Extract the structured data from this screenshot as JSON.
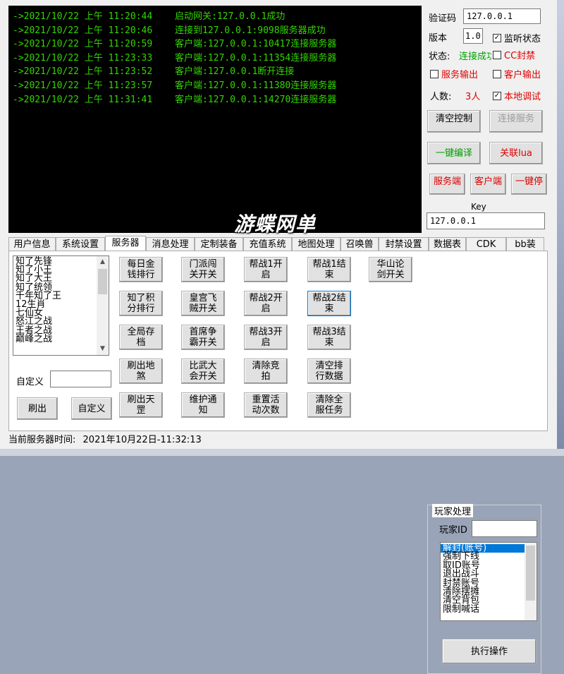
{
  "console": {
    "lines": [
      {
        "time": "->2021/10/22 上午 11:20:44",
        "msg": "启动网关:127.0.0.1成功"
      },
      {
        "time": "->2021/10/22 上午 11:20:46",
        "msg": "连接到127.0.0.1:9098服务器成功"
      },
      {
        "time": "->2021/10/22 上午 11:20:59",
        "msg": "客户端:127.0.0.1:10417连接服务器"
      },
      {
        "time": "->2021/10/22 上午 11:23:33",
        "msg": "客户端:127.0.0.1:11354连接服务器"
      },
      {
        "time": "->2021/10/22 上午 11:23:52",
        "msg": "客户端:127.0.0.1断开连接"
      },
      {
        "time": "->2021/10/22 上午 11:23:57",
        "msg": "客户端:127.0.0.1:11380连接服务器"
      },
      {
        "time": "->2021/10/22 上午 11:31:41",
        "msg": "客户端:127.0.0.1:14270连接服务器"
      }
    ]
  },
  "panel": {
    "verify_label": "验证码",
    "verify_value": "127.0.0.1",
    "version_label": "版本",
    "version_value": "1.0",
    "listen_label": "监听状态",
    "status_label": "状态:",
    "status_value": "连接成功",
    "cc_label": "CC封禁",
    "server_out_label": "服务输出",
    "client_out_label": "客户输出",
    "count_label": "人数:",
    "count_value": "3人",
    "local_debug_label": "本地调试",
    "clear_btn": "清空控制",
    "connect_btn": "连接服务",
    "compile_btn": "一键编译",
    "lua_btn": "关联lua",
    "server_btn": "服务端",
    "client_btn": "客户端",
    "stop_btn": "一键停",
    "key_label": "Key",
    "key_value": "127.0.0.1"
  },
  "watermark": "游蝶网单",
  "tabs": [
    "用户信息",
    "系统设置",
    "服务器",
    "消息处理",
    "定制装备",
    "充值系统",
    "地图处理",
    "召唤兽",
    "封禁设置",
    "数据表",
    "CDK",
    "bb装"
  ],
  "active_tab": "服务器",
  "server": {
    "title_list": [
      "知了先锋",
      "知了小王",
      "知了大王",
      "知了统领",
      "千年知了王",
      "12生肖",
      "七仙女",
      "怒江之战",
      "王者之战",
      "巅峰之战"
    ],
    "custom_label": "自定义",
    "custom_value": "",
    "refresh_btn": "刷出",
    "custom_btn": "自定义",
    "buttons": [
      [
        "每日金\n钱排行",
        "门派闯\n关开关",
        "帮战1开\n启",
        "帮战1结\n束",
        "华山论\n剑开关"
      ],
      [
        "知了积\n分排行",
        "皇宫飞\n贼开关",
        "帮战2开\n启",
        "帮战2结\n束"
      ],
      [
        "全局存\n档",
        "首席争\n霸开关",
        "帮战3开\n启",
        "帮战3结\n束"
      ],
      [
        "刷出地\n煞",
        "比武大\n会开关",
        "清除竞\n拍",
        "清空排\n行数据"
      ],
      [
        "刷出天\n罡",
        "维护通\n知",
        "重置活\n动次数",
        "清除全\n服任务"
      ]
    ],
    "player": {
      "group_title": "玩家处理",
      "id_label": "玩家ID",
      "id_value": "",
      "actions": [
        "解封(账号)",
        "强制下线",
        "取ID账号",
        "退出战斗",
        "封禁账号",
        "清除摆摊",
        "清空背包",
        "限制喊话"
      ],
      "selected_action": "解封(账号)",
      "execute_btn": "执行操作"
    }
  },
  "status_bar": {
    "label": "当前服务器时间:",
    "value": "2021年10月22日-11:32:13"
  }
}
